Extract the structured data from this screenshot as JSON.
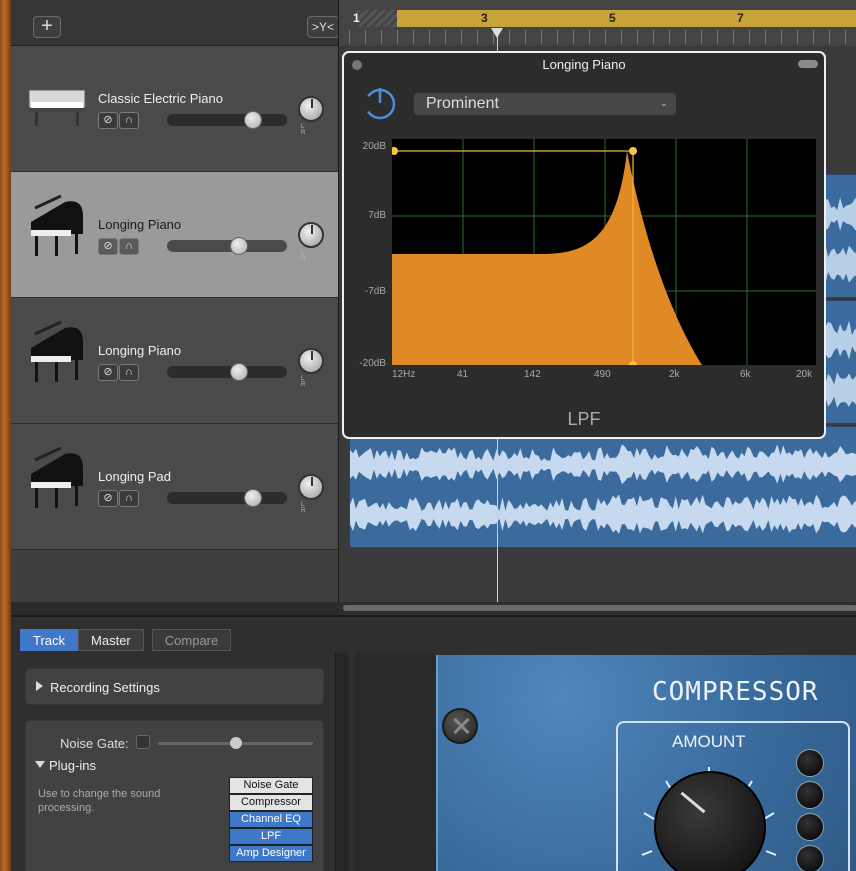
{
  "header": {
    "add_icon": "plus-icon",
    "add_label": "+",
    "filter_icon": "smart-controls-filter-icon",
    "filter_label": ">Y<"
  },
  "ruler": {
    "bars": [
      "1",
      "3",
      "5",
      "7"
    ]
  },
  "tracks": [
    {
      "name": "Classic Electric Piano",
      "instrument_icon": "electric-piano-icon",
      "volume": 0.72,
      "selected": false
    },
    {
      "name": "Longing Piano",
      "instrument_icon": "grand-piano-icon",
      "volume": 0.6,
      "selected": true
    },
    {
      "name": "Longing Piano",
      "instrument_icon": "grand-piano-icon",
      "volume": 0.6,
      "selected": false
    },
    {
      "name": "Longing Pad",
      "instrument_icon": "grand-piano-icon",
      "volume": 0.72,
      "selected": false
    }
  ],
  "track_controls": {
    "mute_label": "⊘",
    "solo_label": "∩",
    "pan_lr": "L R"
  },
  "plugin_popup": {
    "title": "Longing Piano",
    "preset": "Prominent",
    "plugin_name": "LPF",
    "y_axis": [
      "20dB",
      "7dB",
      "-7dB",
      "-20dB"
    ],
    "x_axis": [
      "12Hz",
      "41",
      "142",
      "490",
      "2k",
      "6k",
      "20k"
    ],
    "filter_color": "#e08a25"
  },
  "bottom": {
    "tabs": [
      "Track",
      "Master",
      "Compare"
    ],
    "recording_settings": "Recording Settings",
    "noise_gate_label": "Noise Gate:",
    "plugins_label": "Plug-ins",
    "plugins_desc": "Use to change the sound processing.",
    "plugins": [
      {
        "name": "Noise Gate",
        "active": false
      },
      {
        "name": "Compressor",
        "active": false
      },
      {
        "name": "Channel EQ",
        "active": true
      },
      {
        "name": "LPF",
        "active": true
      },
      {
        "name": "Amp Designer",
        "active": true
      }
    ]
  },
  "compressor": {
    "title": "COMPRESSOR",
    "amount_label": "AMOUNT"
  }
}
